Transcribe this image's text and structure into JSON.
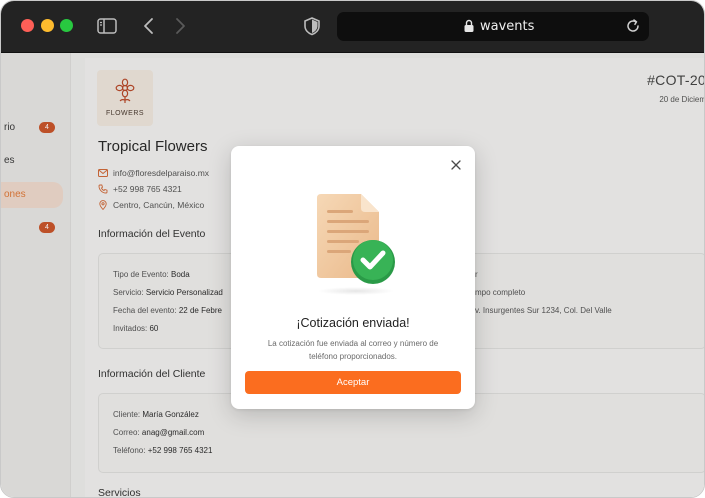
{
  "browser": {
    "url": "wavents",
    "icons": [
      "sidebar-toggle-icon",
      "back-arrow-icon",
      "forward-arrow-icon",
      "shield-icon",
      "lock-icon",
      "reload-icon"
    ]
  },
  "sidebar": {
    "items": [
      {
        "label": "rio",
        "badge": "4",
        "active": false
      },
      {
        "label": "es",
        "badge": "",
        "active": false
      },
      {
        "label": "ones",
        "badge": "",
        "active": true
      },
      {
        "label": "",
        "badge": "4",
        "active": false
      }
    ]
  },
  "business": {
    "logo_text": "FLOWERS",
    "name": "Tropical Flowers",
    "email": "info@floresdelparaiso.mx",
    "phone": "+52 998 765 4321",
    "location": "Centro, Cancún, México"
  },
  "quote": {
    "id": "#COT-20",
    "date": "20 de Diciem"
  },
  "event_section": {
    "title": "Información del Evento",
    "rows": [
      {
        "label": "Tipo de Evento:",
        "value": "Boda"
      },
      {
        "label": "Servicio:",
        "value": "Servicio Personalizad"
      },
      {
        "label": "Fecha del evento:",
        "value": "22 de Febre"
      },
      {
        "label": "Invitados:",
        "value": "60"
      }
    ],
    "right_rows": [
      "r",
      "mpo completo",
      "v. Insurgentes Sur 1234, Col. Del Valle"
    ]
  },
  "client_section": {
    "title": "Información del Cliente",
    "rows": [
      {
        "label": "Cliente:",
        "value": "María González"
      },
      {
        "label": "Correo:",
        "value": "anag@gmail.com"
      },
      {
        "label": "Teléfono:",
        "value": "+52 998 765 4321"
      }
    ]
  },
  "services_section": {
    "title": "Servicios"
  },
  "modal": {
    "title": "¡Cotización enviada!",
    "message": "La cotización fue enviada al correo y número de teléfono proporcionados.",
    "button_label": "Aceptar",
    "illustration": "document-check-icon",
    "accent_color": "#fb6d1f",
    "check_color": "#2fa84f"
  }
}
